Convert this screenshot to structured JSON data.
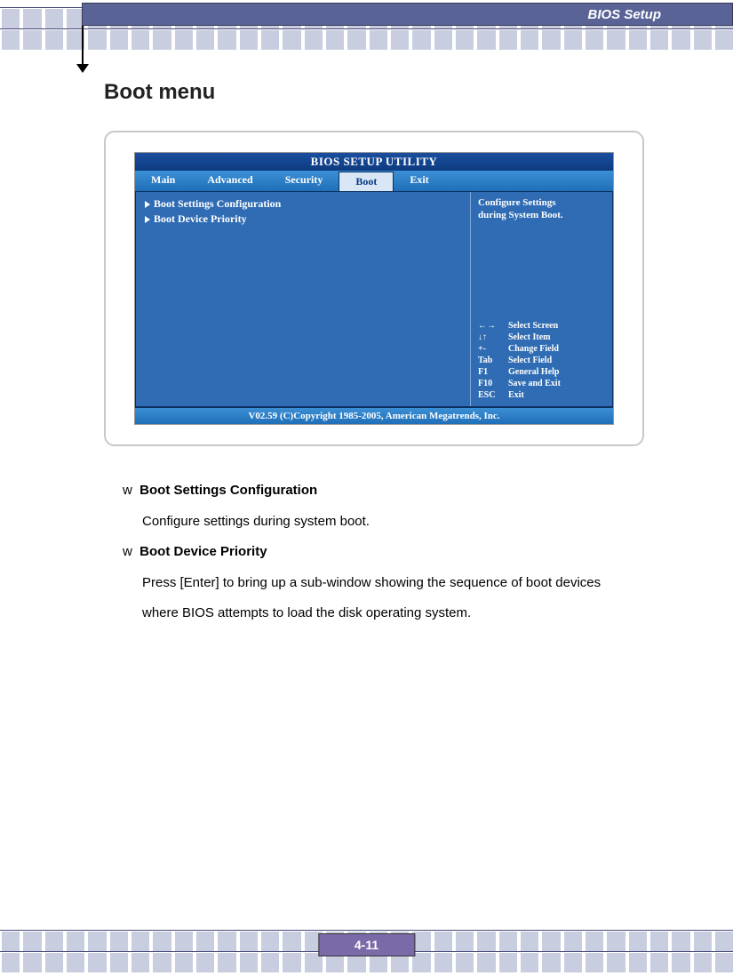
{
  "header": {
    "title": "BIOS Setup"
  },
  "page_title": "Boot menu",
  "bios": {
    "window_title": "BIOS SETUP UTILITY",
    "tabs": [
      "Main",
      "Advanced",
      "Security",
      "Boot",
      "Exit"
    ],
    "active_tab_index": 3,
    "left_items": [
      "Boot Settings Configuration",
      "Boot Device Priority"
    ],
    "help_text_line1": "Configure Settings",
    "help_text_line2": "during System Boot.",
    "keys": [
      {
        "k": "←→",
        "v": "Select Screen"
      },
      {
        "k": "↓↑",
        "v": "Select Item"
      },
      {
        "k": "+-",
        "v": "Change Field"
      },
      {
        "k": "Tab",
        "v": "Select Field"
      },
      {
        "k": "F1",
        "v": "General Help"
      },
      {
        "k": "F10",
        "v": "Save and Exit"
      },
      {
        "k": "ESC",
        "v": "Exit"
      }
    ],
    "footer": "V02.59 (C)Copyright 1985-2005, American Megatrends, Inc."
  },
  "sections": [
    {
      "bullet": "w",
      "title": "Boot Settings Configuration",
      "desc": "Configure settings during system boot."
    },
    {
      "bullet": "w",
      "title": "Boot Device Priority",
      "desc": "Press [Enter] to bring up a sub-window showing the sequence of boot devices where BIOS attempts to load the disk operating system."
    }
  ],
  "page_number": "4-11"
}
